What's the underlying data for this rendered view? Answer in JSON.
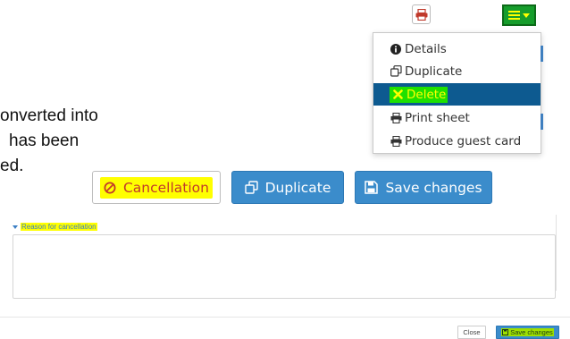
{
  "document_text": {
    "line1": "onverted into",
    "line2": "has been",
    "line3": "ed."
  },
  "toolbar": {
    "print_icon": "print-icon",
    "menu_icon": "hamburger-icon"
  },
  "menu": {
    "items": [
      {
        "label": "Details",
        "icon": "info-circle-icon"
      },
      {
        "label": "Duplicate",
        "icon": "copy-icon"
      },
      {
        "label": "Delete",
        "icon": "times-icon",
        "active": true
      },
      {
        "label": "Print sheet",
        "icon": "print-icon"
      },
      {
        "label": "Produce guest card",
        "icon": "print-icon"
      }
    ]
  },
  "actions": {
    "cancellation_label": "Cancellation",
    "duplicate_label": "Duplicate",
    "save_label": "Save changes"
  },
  "cancellation_panel": {
    "title": "Reason for cancellation",
    "value": ""
  },
  "footer": {
    "close_label": "Close",
    "save_label": "Save changes"
  },
  "colors": {
    "primary": "#3b8ccb",
    "menu_active": "#0d5a90",
    "highlight": "#ffff00",
    "menu_toggle": "#169d2c",
    "danger": "#c23a2b"
  }
}
